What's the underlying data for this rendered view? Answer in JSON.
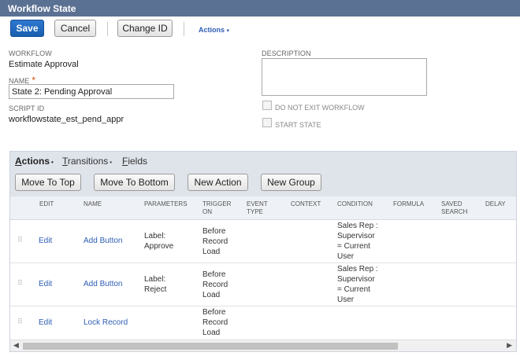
{
  "title": "Workflow State",
  "toolbar": {
    "save": "Save",
    "cancel": "Cancel",
    "change_id": "Change ID",
    "actions": "Actions",
    "actions_caret": "▾"
  },
  "form": {
    "workflow_label": "WORKFLOW",
    "workflow_value": "Estimate Approval",
    "name_label": "NAME",
    "name_required": "*",
    "name_value": "State 2: Pending Approval",
    "script_id_label": "SCRIPT ID",
    "script_id_value": "workflowstate_est_pend_appr",
    "description_label": "DESCRIPTION",
    "description_value": "",
    "do_not_exit_label": "DO NOT EXIT WORKFLOW",
    "do_not_exit_checked": false,
    "start_state_label": "START STATE",
    "start_state_checked": false
  },
  "subtabs": [
    {
      "label": "Actions",
      "hotkey": "A",
      "rest": "ctions",
      "dot": "•"
    },
    {
      "label": "Transitions",
      "hotkey": "T",
      "rest": "ransitions",
      "dot": "•"
    },
    {
      "label": "Fields",
      "hotkey": "F",
      "rest": "ields",
      "dot": ""
    }
  ],
  "grid_buttons": {
    "move_top": "Move To Top",
    "move_bottom": "Move To Bottom",
    "new_action": "New Action",
    "new_group": "New Group"
  },
  "columns": {
    "edit": "EDIT",
    "name": "NAME",
    "parameters": "PARAMETERS",
    "trigger_on_1": "TRIGGER",
    "trigger_on_2": "ON",
    "event_type_1": "EVENT",
    "event_type_2": "TYPE",
    "context": "CONTEXT",
    "condition": "CONDITION",
    "formula": "FORMULA",
    "saved_search_1": "SAVED",
    "saved_search_2": "SEARCH",
    "delay": "DELAY"
  },
  "rows": [
    {
      "edit": "Edit",
      "name": "Add Button",
      "param_1": "Label:",
      "param_2": "Approve",
      "trig_1": "Before",
      "trig_2": "Record",
      "trig_3": "Load",
      "cond_1": "Sales Rep :",
      "cond_2": "Supervisor",
      "cond_3": "= Current",
      "cond_4": "User"
    },
    {
      "edit": "Edit",
      "name": "Add Button",
      "param_1": "Label:",
      "param_2": "Reject",
      "trig_1": "Before",
      "trig_2": "Record",
      "trig_3": "Load",
      "cond_1": "Sales Rep :",
      "cond_2": "Supervisor",
      "cond_3": "= Current",
      "cond_4": "User"
    },
    {
      "edit": "Edit",
      "name": "Lock Record",
      "param_1": "",
      "param_2": "",
      "trig_1": "Before",
      "trig_2": "Record",
      "trig_3": "Load",
      "cond_1": "",
      "cond_2": "",
      "cond_3": "",
      "cond_4": ""
    }
  ],
  "scrollbar": {
    "left_arrow": "◀",
    "right_arrow": "▶"
  },
  "icons": {
    "drag_handle": "⠿"
  },
  "colors": {
    "titlebar": "#5b7193",
    "primary_button": "#1a5fb0",
    "link": "#2e5db4",
    "required": "#d24a00"
  }
}
